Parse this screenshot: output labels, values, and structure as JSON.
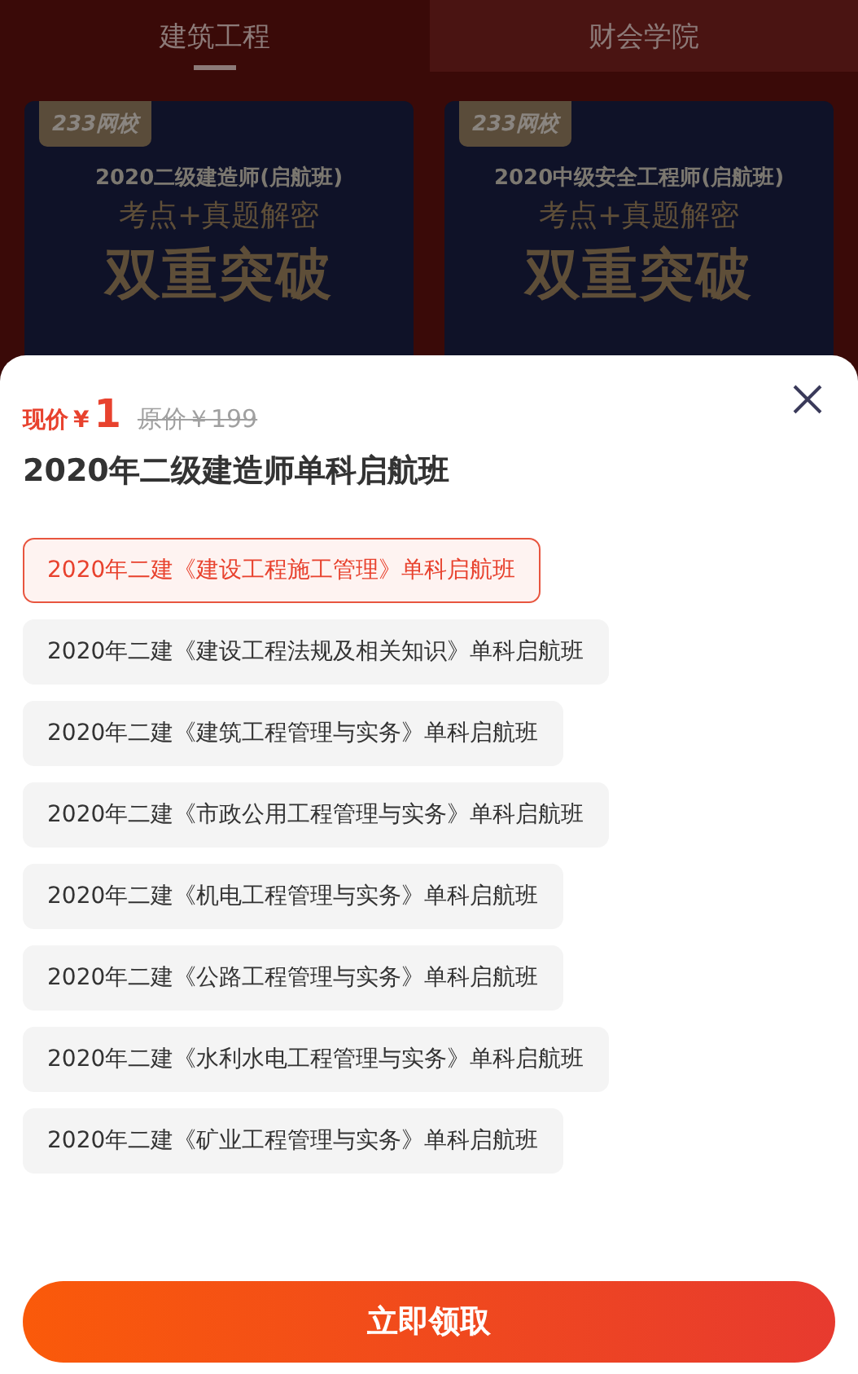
{
  "tabs": [
    {
      "label": "建筑工程",
      "selected": true
    },
    {
      "label": "财会学院",
      "selected": false
    }
  ],
  "cards": [
    {
      "logo": "233网校",
      "subtitle": "2020二级建造师(启航班)",
      "tagline": "考点+真题解密",
      "headline": "双重突破"
    },
    {
      "logo": "233网校",
      "subtitle": "2020中级安全工程师(启航班)",
      "tagline": "考点+真题解密",
      "headline": "双重突破"
    }
  ],
  "sheet": {
    "price_label": "现价",
    "currency": "¥",
    "price": "1",
    "original_price": "原价￥199",
    "title": "2020年二级建造师单科启航班",
    "options": [
      {
        "label": "2020年二建《建设工程施工管理》单科启航班",
        "selected": true
      },
      {
        "label": "2020年二建《建设工程法规及相关知识》单科启航班",
        "selected": false
      },
      {
        "label": "2020年二建《建筑工程管理与实务》单科启航班",
        "selected": false
      },
      {
        "label": "2020年二建《市政公用工程管理与实务》单科启航班",
        "selected": false
      },
      {
        "label": "2020年二建《机电工程管理与实务》单科启航班",
        "selected": false
      },
      {
        "label": "2020年二建《公路工程管理与实务》单科启航班",
        "selected": false
      },
      {
        "label": "2020年二建《水利水电工程管理与实务》单科启航班",
        "selected": false
      },
      {
        "label": "2020年二建《矿业工程管理与实务》单科启航班",
        "selected": false
      }
    ],
    "button": "立即领取"
  }
}
